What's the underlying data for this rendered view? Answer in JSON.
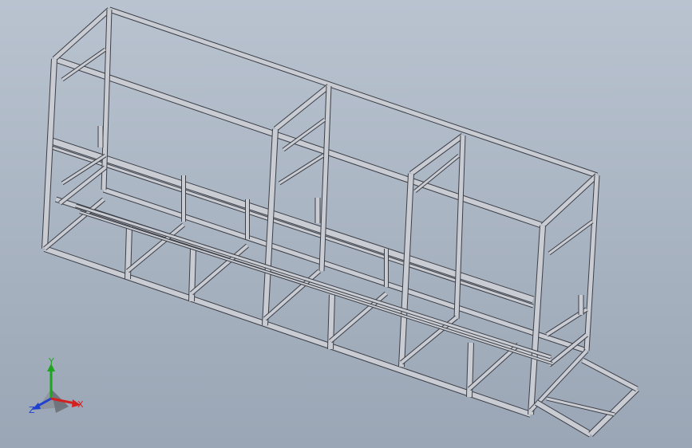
{
  "viewport": {
    "background_top": "#b9c3d0",
    "background_bottom": "#9aa6b5"
  },
  "model": {
    "frame_fill": "#c9ccd3",
    "frame_edge": "#3d3f47",
    "frame_shadow": "#8d929c"
  },
  "triad": {
    "x_label": "X",
    "y_label": "Y",
    "z_label": "Z",
    "x_color": "#d52020",
    "y_color": "#1ea41e",
    "z_color": "#2040d0"
  }
}
